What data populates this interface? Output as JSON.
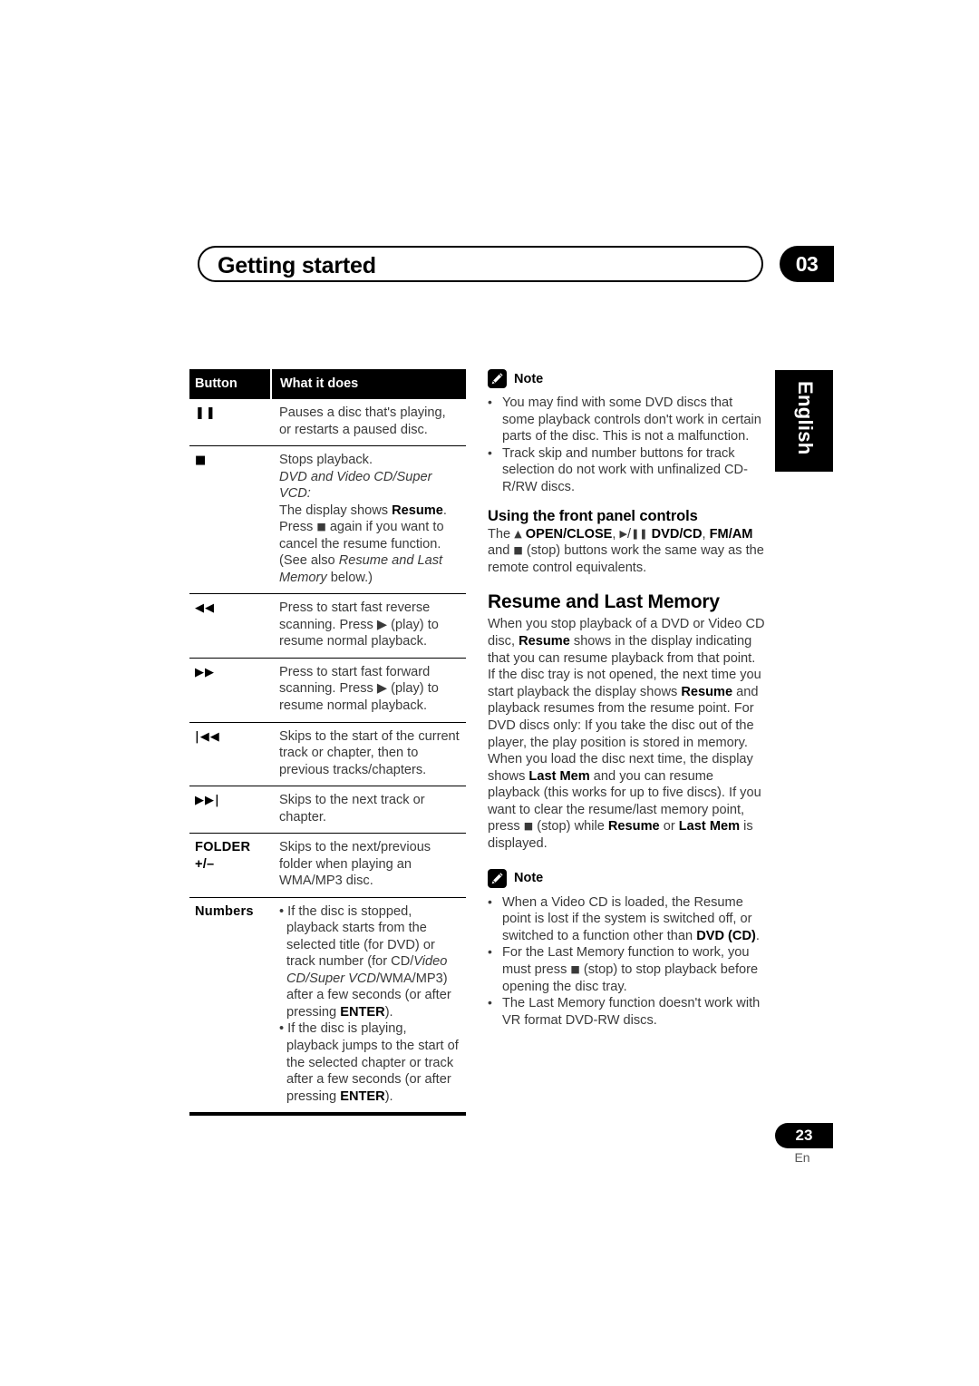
{
  "header": {
    "title": "Getting started",
    "chapter": "03"
  },
  "side_tab": {
    "language": "English"
  },
  "table": {
    "headers": {
      "button": "Button",
      "what_it_does": "What it does"
    },
    "rows": [
      {
        "button_icon": "pause-icon",
        "button_glyph": "❚❚",
        "lines": [
          {
            "type": "plain",
            "text": "Pauses a disc that's playing, or restarts a paused disc."
          }
        ]
      },
      {
        "button_icon": "stop-icon",
        "button_glyph": "■",
        "lines": [
          {
            "type": "plain",
            "text": "Stops playback."
          },
          {
            "type": "italic",
            "text": "DVD and Video CD/Super VCD:"
          },
          {
            "type": "mixed",
            "text": "The display shows Resume.",
            "bold_parts": [
              "Resume"
            ]
          },
          {
            "type": "mixed",
            "text": "Press ■ again if you want to cancel the resume function.",
            "bold_parts": []
          },
          {
            "type": "mixed",
            "text": "(See also Resume and Last Memory below.)",
            "italic_parts": [
              "Resume and Last Memory"
            ]
          }
        ]
      },
      {
        "button_icon": "fast-reverse-icon",
        "button_glyph": "◀◀",
        "lines": [
          {
            "type": "plain",
            "text": "Press to start fast reverse scanning. Press ▶ (play) to resume normal playback."
          }
        ]
      },
      {
        "button_icon": "fast-forward-icon",
        "button_glyph": "▶▶",
        "lines": [
          {
            "type": "plain",
            "text": "Press to start fast forward scanning. Press ▶ (play) to resume normal playback."
          }
        ]
      },
      {
        "button_icon": "previous-track-icon",
        "button_glyph": "|◀◀",
        "lines": [
          {
            "type": "plain",
            "text": "Skips to the start of the current track or chapter, then to previous tracks/chapters."
          }
        ]
      },
      {
        "button_icon": "next-track-icon",
        "button_glyph": "▶▶|",
        "lines": [
          {
            "type": "plain",
            "text": "Skips to the next track or chapter."
          }
        ]
      },
      {
        "button_icon": "folder-label",
        "button_glyph": "FOLDER +/–",
        "lines": [
          {
            "type": "plain",
            "text": "Skips to the next/previous folder when playing an WMA/MP3 disc."
          }
        ]
      },
      {
        "button_icon": "numbers-label",
        "button_glyph": "Numbers",
        "lines": [
          {
            "type": "bullet",
            "text": "• If the disc is stopped, playback starts from the selected title (for DVD) or track number (for CD/Video CD/Super VCD/WMA/MP3) after a few seconds (or after pressing ENTER)."
          },
          {
            "type": "bullet",
            "text": "• If the disc is playing, playback jumps to the start of the selected chapter or track after a few seconds (or after pressing ENTER)."
          }
        ]
      }
    ]
  },
  "notes": {
    "label": "Note",
    "icon": "pencil-icon",
    "top_items": [
      "You may find with some DVD discs that some playback controls don't work in certain parts of the disc. This is not a malfunction.",
      "Track skip and number buttons for track selection do not work with unfinalized CD-R/RW discs."
    ],
    "bottom_items": [
      "When a Video CD is loaded, the Resume point is lost if the system is switched off, or switched to a function other than DVD (CD).",
      "For the Last Memory function to work, you must press ■ (stop) to stop playback before opening the disc tray.",
      "The Last Memory function doesn't work with VR format DVD-RW discs."
    ]
  },
  "front_panel": {
    "heading": "Using the front panel controls",
    "body": "The ▲ OPEN/CLOSE, ▶/❚❚ DVD/CD, FM/AM and ■ (stop) buttons work the same way as the remote control equivalents."
  },
  "resume": {
    "heading": "Resume and Last Memory",
    "body": "When you stop playback of a DVD or Video CD disc, Resume shows in the display indicating that you can resume playback from that point. If the disc tray is not opened, the next time you start playback the display shows Resume and playback resumes from the resume point. For DVD discs only: If you take the disc out of the player, the play position is stored in memory. When you load the disc next time, the display shows Last Mem and you can resume playback (this works for up to five discs). If you want to clear the resume/last memory point, press ■ (stop) while Resume or Last Mem is displayed."
  },
  "footer": {
    "page_number": "23",
    "language_code": "En"
  }
}
